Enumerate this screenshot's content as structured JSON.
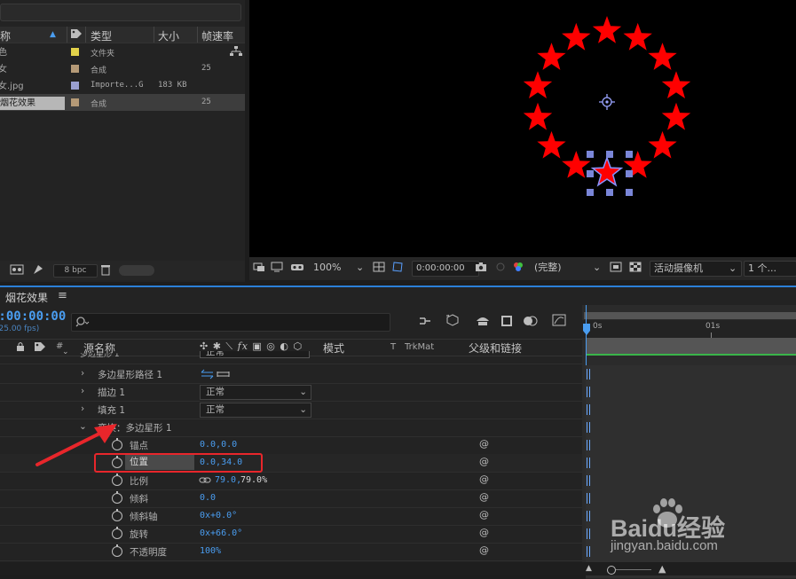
{
  "project": {
    "columns": {
      "name": "称",
      "type": "类型",
      "size": "大小",
      "fps": "帧速率"
    },
    "items": [
      {
        "name": "花色",
        "color": "#e2d24a",
        "type": "文件夹",
        "size": "",
        "fps": ""
      },
      {
        "name": "少女",
        "color": "#b59a77",
        "type": "合成",
        "size": "",
        "fps": "25"
      },
      {
        "name": "少女.jpg",
        "color": "#9a9fd0",
        "type": "Importe...G",
        "size": "183 KB",
        "fps": ""
      },
      {
        "name": "烟花效果",
        "color": "#b59a77",
        "type": "合成",
        "size": "",
        "fps": "25"
      }
    ],
    "bpc": "8 bpc"
  },
  "viewer": {
    "zoom": "100%",
    "timecode": "0:00:00:00",
    "resolution": "(完整)",
    "camera": "活动摄像机",
    "views": "1 个..."
  },
  "timeline": {
    "tab_title": "烟花效果",
    "menu_icon": "≡",
    "timecode": "0:00:00:00",
    "fps": "(25.00 fps)",
    "search_placeholder": "",
    "col_hash": "#",
    "col_source": "源名称",
    "col_mode": "模式",
    "col_t": "T",
    "col_trkmat": "TrkMat",
    "col_parent": "父级和链接",
    "ruler_0": "0s",
    "ruler_1": "01s",
    "rows": {
      "header_partial": "多边星形 1",
      "header_partial_mode": "正常",
      "path": "多边星形路径 1",
      "stroke": "描边 1",
      "stroke_mode": "正常",
      "fill": "填充 1",
      "fill_mode": "正常",
      "transform": "变换：多边星形 1",
      "anchor": "锚点",
      "anchor_val": "0.0,0.0",
      "position": "位置",
      "position_val": "0.0,34.0",
      "scale": "比例",
      "scale_val_x": "79.0,",
      "scale_val_y": "79.0%",
      "skew": "倾斜",
      "skew_val": "0.0",
      "skew_axis": "倾斜轴",
      "skew_axis_val": "0x+0.0°",
      "rotation": "旋转",
      "rotation_val": "0x+66.0°",
      "opacity": "不透明度",
      "opacity_val": "100%"
    }
  },
  "watermark": {
    "brand": "Baidu经验",
    "url": "jingyan.baidu.com"
  }
}
